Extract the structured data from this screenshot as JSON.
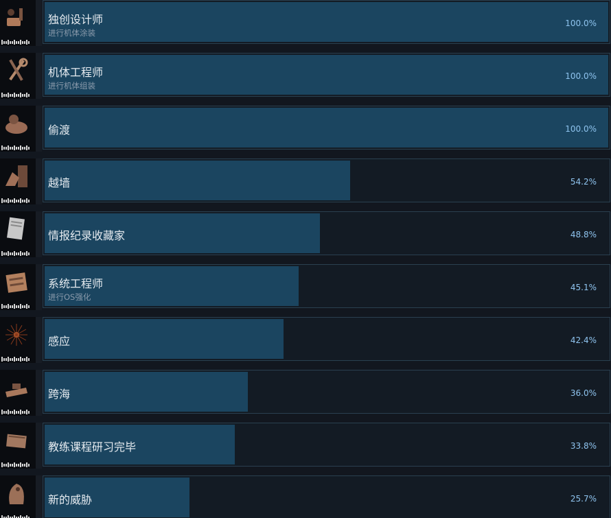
{
  "achievements": [
    {
      "name": "独创设计师",
      "description": "进行机体涂装",
      "percent_label": "100.0%",
      "percent": 100.0,
      "icon": "paint-brush-icon",
      "tone": "#b07a5a"
    },
    {
      "name": "机体工程师",
      "description": "进行机体组装",
      "percent_label": "100.0%",
      "percent": 100.0,
      "icon": "wrench-icon",
      "tone": "#b58a6c"
    },
    {
      "name": "偷渡",
      "description": "",
      "percent_label": "100.0%",
      "percent": 100.0,
      "icon": "stowaway-icon",
      "tone": "#9a6b55"
    },
    {
      "name": "越墙",
      "description": "",
      "percent_label": "54.2%",
      "percent": 54.2,
      "icon": "wall-climb-icon",
      "tone": "#a07058"
    },
    {
      "name": "情报纪录收藏家",
      "description": "",
      "percent_label": "48.8%",
      "percent": 48.8,
      "icon": "data-log-icon",
      "tone": "#c8c8c8"
    },
    {
      "name": "系统工程师",
      "description": "进行OS强化",
      "percent_label": "45.1%",
      "percent": 45.1,
      "icon": "system-chip-icon",
      "tone": "#b3805e"
    },
    {
      "name": "感应",
      "description": "",
      "percent_label": "42.4%",
      "percent": 42.4,
      "icon": "sense-burst-icon",
      "tone": "#d9743e"
    },
    {
      "name": "跨海",
      "description": "",
      "percent_label": "36.0%",
      "percent": 36.0,
      "icon": "sea-crossing-icon",
      "tone": "#a9785c"
    },
    {
      "name": "教练课程研习完毕",
      "description": "",
      "percent_label": "33.8%",
      "percent": 33.8,
      "icon": "training-manual-icon",
      "tone": "#a27860"
    },
    {
      "name": "新的威胁",
      "description": "",
      "percent_label": "25.7%",
      "percent": 25.7,
      "icon": "new-threat-icon",
      "tone": "#9c7058"
    }
  ]
}
